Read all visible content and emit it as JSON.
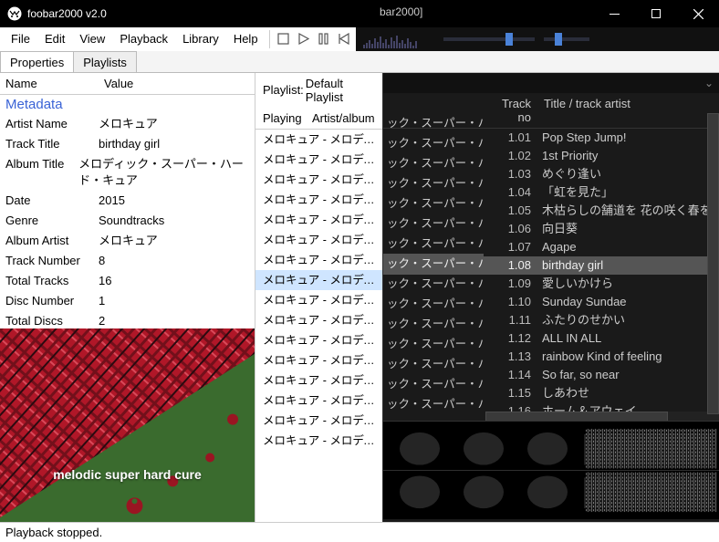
{
  "window": {
    "title": "foobar2000 v2.0",
    "secondary_title": "bar2000]"
  },
  "menu": [
    "File",
    "Edit",
    "View",
    "Playback",
    "Library",
    "Help"
  ],
  "tabs_left": {
    "items": [
      "Properties",
      "Playlists"
    ],
    "active": 0
  },
  "prop_header": {
    "name": "Name",
    "value": "Value"
  },
  "prop_section": "Metadata",
  "properties": [
    {
      "k": "Artist Name",
      "v": "メロキュア"
    },
    {
      "k": "Track Title",
      "v": "birthday girl"
    },
    {
      "k": "Album Title",
      "v": "メロディック・スーパー・ハード・キュア"
    },
    {
      "k": "Date",
      "v": "2015"
    },
    {
      "k": "Genre",
      "v": "Soundtracks"
    },
    {
      "k": "Album Artist",
      "v": "メロキュア"
    },
    {
      "k": "Track Number",
      "v": "8"
    },
    {
      "k": "Total Tracks",
      "v": "16"
    },
    {
      "k": "Disc Number",
      "v": "1"
    },
    {
      "k": "Total Discs",
      "v": "2"
    }
  ],
  "albumart": {
    "caption": "melodic super hard cure"
  },
  "playlist_header": {
    "label": "Playlist:",
    "selected": "Default Playlist"
  },
  "mid_header": {
    "playing": "Playing",
    "artist": "Artist/album"
  },
  "mid_rows": [
    "メロキュア - メロディック・スーパー・ハード...",
    "メロキュア - メロディック・スーパー・ハード...",
    "メロキュア - メロディック・スーパー・ハード...",
    "メロキュア - メロディック・スーパー・ハード...",
    "メロキュア - メロディック・スーパー・ハード...",
    "メロキュア - メロディック・スーパー・ハード...",
    "メロキュア - メロディック・スーパー・ハード...",
    "メロキュア - メロディック・スーパー・ハード...",
    "メロキュア - メロディック・スーパー・ハード...",
    "メロキュア - メロディック・スーパー・ハード...",
    "メロキュア - メロディック・スーパー・ハード...",
    "メロキュア - メロディック・スーパー・ハード...",
    "メロキュア - メロディック・スーパー・ハード...",
    "メロキュア - メロディック・スーパー・ハード...",
    "メロキュア - メロディック・スーパー・ハード...",
    "メロキュア - メロディック・スーパー・ハード..."
  ],
  "mid_selected_index": 7,
  "overlay_rows": [
    "ック・スーパー・ハード...",
    "ック・スーパー・ハード...",
    "ック・スーパー・ハード...",
    "ック・スーパー・ハード...",
    "ック・スーパー・ハード...",
    "ック・スーパー・ハード...",
    "ック・スーパー・ハード...",
    "ック・スーパー・ハード...",
    "ック・スーパー・ハード...",
    "ック・スーパー・ハード...",
    "ック・スーパー・ハード...",
    "ック・スーパー・ハード...",
    "ック・スーパー・ハード...",
    "ック・スーパー・ハード...",
    "ック・スーパー・ハード...",
    "ック・スーパー・ハード..."
  ],
  "right_header": {
    "trackno": "Track no",
    "title": "Title / track artist"
  },
  "right_rows": [
    {
      "no": "1.01",
      "t": "Pop Step Jump!"
    },
    {
      "no": "1.02",
      "t": "1st Priority"
    },
    {
      "no": "1.03",
      "t": "めぐり逢い"
    },
    {
      "no": "1.04",
      "t": "「虹を見た」"
    },
    {
      "no": "1.05",
      "t": "木枯らしの舗道を 花の咲く春を"
    },
    {
      "no": "1.06",
      "t": "向日葵"
    },
    {
      "no": "1.07",
      "t": "Agape"
    },
    {
      "no": "1.08",
      "t": "birthday girl"
    },
    {
      "no": "1.09",
      "t": "愛しいかけら"
    },
    {
      "no": "1.10",
      "t": "Sunday Sundae"
    },
    {
      "no": "1.11",
      "t": "ふたりのせかい"
    },
    {
      "no": "1.12",
      "t": "ALL IN ALL"
    },
    {
      "no": "1.13",
      "t": "rainbow Kind of feeling"
    },
    {
      "no": "1.14",
      "t": "So far, so near"
    },
    {
      "no": "1.15",
      "t": "しあわせ"
    },
    {
      "no": "1.16",
      "t": "ホーム＆アウェイ"
    }
  ],
  "right_selected_index": 7,
  "status": "Playback stopped."
}
